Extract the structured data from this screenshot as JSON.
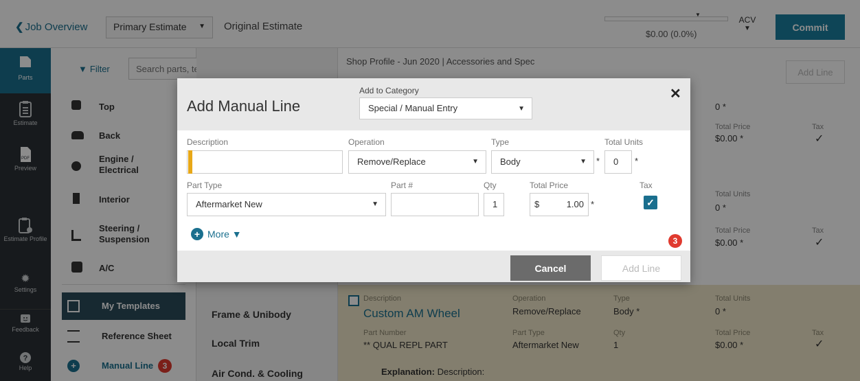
{
  "topbar": {
    "back_label": "Job Overview",
    "estimate_select": "Primary Estimate",
    "original_estimate": "Original Estimate",
    "progress_fraction": 0.0,
    "progress_text": "$0.00 (0.0%)",
    "acv_label": "ACV",
    "commit_label": "Commit"
  },
  "rail": {
    "items": [
      {
        "label": "Parts",
        "icon": "parts-icon"
      },
      {
        "label": "Estimate",
        "icon": "estimate-icon"
      },
      {
        "label": "Preview",
        "icon": "pdf-preview-icon"
      },
      {
        "label": "Estimate Profile",
        "icon": "estimate-profile-icon"
      },
      {
        "label": "Settings",
        "icon": "gear-icon"
      },
      {
        "label": "Feedback",
        "icon": "feedback-icon"
      },
      {
        "label": "Help",
        "icon": "help-icon"
      }
    ],
    "pdf_glyph": "PDF"
  },
  "parts": {
    "filter_label": "Filter",
    "search_placeholder": "Search parts, templates, ref sheet",
    "categories": [
      {
        "label": "Top"
      },
      {
        "label": "Back"
      },
      {
        "label": "Engine / Electrical"
      },
      {
        "label": "Interior"
      },
      {
        "label": "Steering / Suspension"
      },
      {
        "label": "A/C"
      }
    ],
    "my_templates": "My Templates",
    "reference_sheet": "Reference Sheet",
    "manual_line": "Manual Line",
    "manual_line_badge": "3"
  },
  "mid": {
    "items": [
      "Frame & Unibody",
      "Local Trim",
      "Air Cond. & Cooling"
    ]
  },
  "content": {
    "shop_profile": "Shop Profile - Jun 2020 | Accessories and Spec",
    "add_line_label": "Add Line",
    "rows": [
      {
        "units_label": "",
        "units_value": "0 *",
        "price_label": "Total Price",
        "price_value": "$0.00 *",
        "tax_label": "Tax",
        "tax_value": "✓"
      },
      {
        "units_label": "Total Units",
        "units_value": "0 *",
        "price_label": "Total Price",
        "price_value": "$0.00 *",
        "tax_label": "Tax",
        "tax_value": "✓"
      }
    ],
    "card": {
      "desc_label": "Description",
      "title": "Custom AM Wheel",
      "op_label": "Operation",
      "op_value": "Remove/Replace",
      "type_label": "Type",
      "type_value": "Body *",
      "units_label": "Total Units",
      "units_value": "0 *",
      "partnum_label": "Part Number",
      "partnum_value": "** QUAL REPL PART",
      "parttype_label": "Part Type",
      "parttype_value": "Aftermarket New",
      "qty_label": "Qty",
      "qty_value": "1",
      "price_label": "Total Price",
      "price_value": "$0.00 *",
      "tax_label": "Tax",
      "tax_value": "✓",
      "explanation_label": "Explanation:",
      "explanation_value": "Description:"
    }
  },
  "modal": {
    "title": "Add Manual Line",
    "category_label": "Add to Category",
    "category_value": "Special / Manual Entry",
    "close_glyph": "✕",
    "description_label": "Description",
    "description_value": "",
    "operation_label": "Operation",
    "operation_value": "Remove/Replace",
    "type_label": "Type",
    "type_value": "Body",
    "total_units_label": "Total Units",
    "total_units_value": "0",
    "part_type_label": "Part Type",
    "part_type_value": "Aftermarket New",
    "part_num_label": "Part #",
    "part_num_value": "",
    "qty_label": "Qty",
    "qty_value": "1",
    "total_price_label": "Total Price",
    "currency": "$",
    "total_price_value": "1.00",
    "tax_label": "Tax",
    "tax_checked": true,
    "required_mark": "*",
    "more_label": "More ▼",
    "badge": "3",
    "cancel_label": "Cancel",
    "add_line_label": "Add Line"
  },
  "colors": {
    "accent": "#1a6f8e",
    "rail": "#2b3035",
    "badge": "#e03a2f",
    "card": "#efe6c8"
  }
}
